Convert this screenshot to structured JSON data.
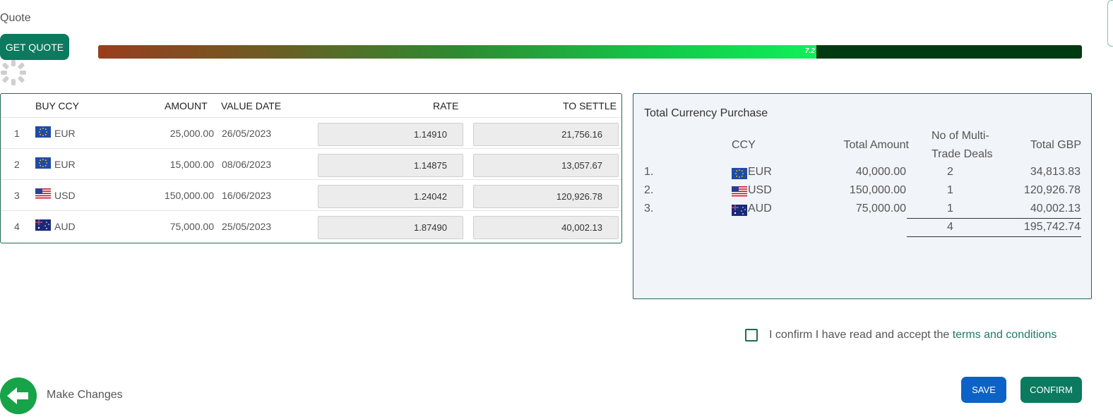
{
  "quote": {
    "label": "Quote",
    "get_quote_label": "GET QUOTE",
    "progress_percent": 73,
    "progress_value": "7.2"
  },
  "deals_table": {
    "headers": {
      "buy_ccy": "BUY CCY",
      "amount": "AMOUNT",
      "value_date": "VALUE DATE",
      "rate": "RATE",
      "to_settle": "TO SETTLE"
    },
    "rows": [
      {
        "index": "1",
        "flag": "eu-flag-icon",
        "ccy": "EUR",
        "amount": "25,000.00",
        "value_date": "26/05/2023",
        "rate": "1.14910",
        "to_settle": "21,756.16"
      },
      {
        "index": "2",
        "flag": "eu-flag-icon",
        "ccy": "EUR",
        "amount": "15,000.00",
        "value_date": "08/06/2023",
        "rate": "1.14875",
        "to_settle": "13,057.67"
      },
      {
        "index": "3",
        "flag": "us-flag-icon",
        "ccy": "USD",
        "amount": "150,000.00",
        "value_date": "16/06/2023",
        "rate": "1.24042",
        "to_settle": "120,926.78"
      },
      {
        "index": "4",
        "flag": "au-flag-icon",
        "ccy": "AUD",
        "amount": "75,000.00",
        "value_date": "25/05/2023",
        "rate": "1.87490",
        "to_settle": "40,002.13"
      }
    ]
  },
  "summary": {
    "title": "Total Currency Purchase",
    "headers": {
      "ccy": "CCY",
      "total_amount": "Total Amount",
      "deals_line1": "No of Multi-",
      "deals_line2": "Trade Deals",
      "total_gbp": "Total GBP"
    },
    "rows": [
      {
        "index": "1.",
        "flag": "eu-flag-icon",
        "ccy": "EUR",
        "total_amount": "40,000.00",
        "deals": "2",
        "total_gbp": "34,813.83"
      },
      {
        "index": "2.",
        "flag": "us-flag-icon",
        "ccy": "USD",
        "total_amount": "150,000.00",
        "deals": "1",
        "total_gbp": "120,926.78"
      },
      {
        "index": "3.",
        "flag": "au-flag-icon",
        "ccy": "AUD",
        "total_amount": "75,000.00",
        "deals": "1",
        "total_gbp": "40,002.13"
      }
    ],
    "totals": {
      "deals": "4",
      "total_gbp": "195,742.74"
    }
  },
  "confirm": {
    "text": "I confirm I have read and accept the ",
    "link": "terms and conditions",
    "checked": false
  },
  "actions": {
    "make_changes": "Make Changes",
    "save": "SAVE",
    "confirm": "CONFIRM"
  },
  "colors": {
    "primary_green": "#0b7a5e",
    "save_blue": "#0d62c8",
    "back_green": "#17a347",
    "panel_border": "#1e6b55"
  }
}
